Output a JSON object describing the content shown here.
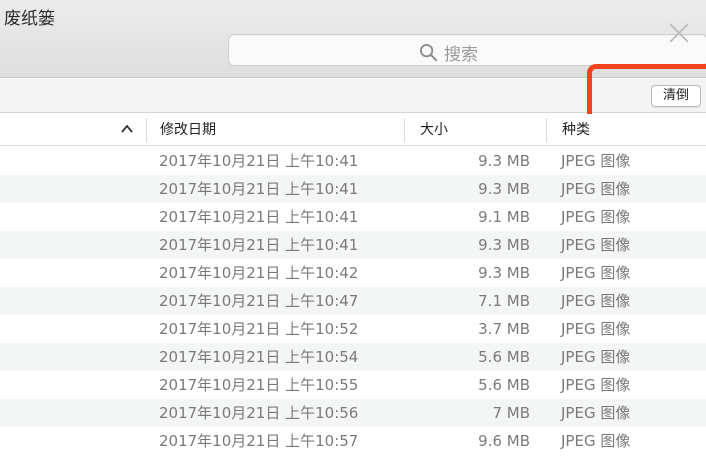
{
  "window": {
    "title": "废纸篓"
  },
  "search": {
    "placeholder": "搜索",
    "icon": "search-icon"
  },
  "toolbar": {
    "empty_label": "清倒"
  },
  "highlight": {
    "color": "#f2421e"
  },
  "columns": {
    "date": "修改日期",
    "size": "大小",
    "kind": "种类",
    "sort_icon": "chevron-up-icon"
  },
  "rows": [
    {
      "date": "2017年10月21日 上午10:41",
      "size": "9.3 MB",
      "kind": "JPEG 图像"
    },
    {
      "date": "2017年10月21日 上午10:41",
      "size": "9.3 MB",
      "kind": "JPEG 图像"
    },
    {
      "date": "2017年10月21日 上午10:41",
      "size": "9.1 MB",
      "kind": "JPEG 图像"
    },
    {
      "date": "2017年10月21日 上午10:41",
      "size": "9.3 MB",
      "kind": "JPEG 图像"
    },
    {
      "date": "2017年10月21日 上午10:42",
      "size": "9.3 MB",
      "kind": "JPEG 图像"
    },
    {
      "date": "2017年10月21日 上午10:47",
      "size": "7.1 MB",
      "kind": "JPEG 图像"
    },
    {
      "date": "2017年10月21日 上午10:52",
      "size": "3.7 MB",
      "kind": "JPEG 图像"
    },
    {
      "date": "2017年10月21日 上午10:54",
      "size": "5.6 MB",
      "kind": "JPEG 图像"
    },
    {
      "date": "2017年10月21日 上午10:55",
      "size": "5.6 MB",
      "kind": "JPEG 图像"
    },
    {
      "date": "2017年10月21日 上午10:56",
      "size": "7 MB",
      "kind": "JPEG 图像"
    },
    {
      "date": "2017年10月21日 上午10:57",
      "size": "9.6 MB",
      "kind": "JPEG 图像"
    }
  ]
}
